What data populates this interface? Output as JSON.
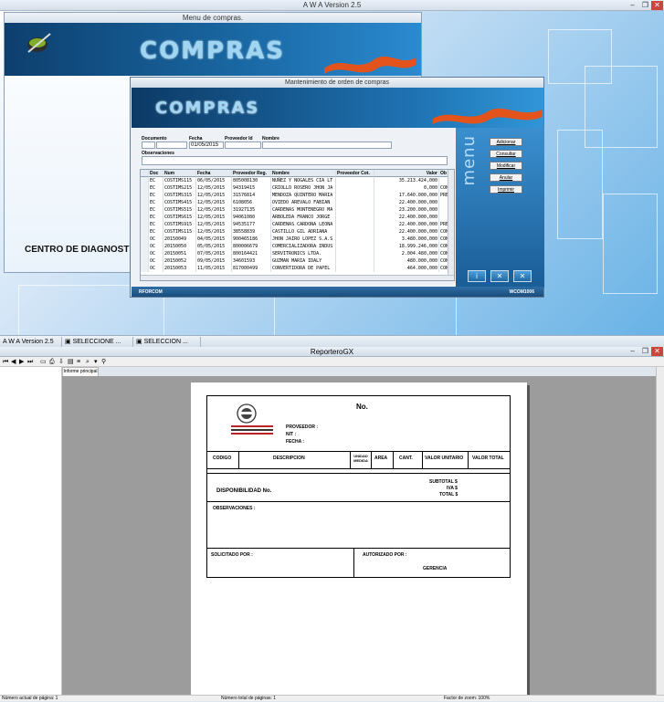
{
  "app": {
    "title": "A W A Version 2.5"
  },
  "menu_window": {
    "title": "Menu de compras.",
    "banner": "COMPRAS",
    "body_text": "CENTRO DE DIAGNOSTIC"
  },
  "mant_window": {
    "title": "Mantenimiento de orden de compras",
    "banner": "COMPRAS",
    "side_banner": "menu",
    "fields": {
      "documento_label": "Documento",
      "fecha_label": "Fecha",
      "fecha_value": "01/05/2015",
      "proveedor_label": "Proveedor Id",
      "nombre_label": "Nombre",
      "observaciones_label": "Observaciones"
    },
    "grid": {
      "headers": [
        "Doc",
        "Num",
        "Fecha",
        "Proveedor Reg.",
        "Nombre",
        "Proveedor Cot.",
        "Valor",
        "Ob"
      ],
      "rows": [
        [
          "EC",
          "COSTIMS115",
          "06/05/2015",
          "805008130",
          "NUÑEZ Y NOGALES CIA LT",
          "",
          "35.213.424,000",
          ""
        ],
        [
          "EC",
          "COSTIMS215",
          "12/05/2015",
          "94319415",
          "CRIOLLO ROSERO JHON JA",
          "",
          "0,000",
          "CON"
        ],
        [
          "EC",
          "COSTIMS315",
          "12/05/2015",
          "31576814",
          "MENDOZA QUINTERO MARIA",
          "",
          "17.640.000,000",
          "PRE"
        ],
        [
          "EC",
          "COSTIMS415",
          "12/05/2015",
          "6108056",
          "OVIEDO AREVALO FABIAN",
          "",
          "22.400.000,000",
          ""
        ],
        [
          "EC",
          "COSTIMS515",
          "12/05/2015",
          "31927135",
          "CARDENAS MONTENEGRO MA",
          "",
          "23.200.000,000",
          ""
        ],
        [
          "EC",
          "COSTIMS615",
          "12/05/2015",
          "94061080",
          "ARBOLEDA FRANCO JORGE",
          "",
          "22.400.000,000",
          ""
        ],
        [
          "EC",
          "COSTIMS915",
          "12/05/2015",
          "94535177",
          "CARDENAS CARDONA LEONA",
          "",
          "22.400.000,000",
          "PRE"
        ],
        [
          "EC",
          "COSTIMS115",
          "12/05/2015",
          "38558839",
          "CASTILLO GIL ADRIANA",
          "",
          "22.400.000,000",
          "CON"
        ],
        [
          "OC",
          "20150049",
          "04/05/2015",
          "900465186",
          "JHON JAIRO LOPEZ S.A.S",
          "",
          "3.480.000,000",
          "CON"
        ],
        [
          "OC",
          "20150050",
          "05/05/2015",
          "800006679",
          "COMERCIALIZADORA INDUS",
          "",
          "18.999.246,000",
          "CON"
        ],
        [
          "OC",
          "20150051",
          "07/05/2015",
          "800164421",
          "SERVITRONICS LTDA.",
          "",
          "2.004.480,000",
          "CON"
        ],
        [
          "OC",
          "20150052",
          "09/05/2015",
          "34601593",
          "GUZMAN  MARIA IDALY",
          "",
          "480.000,000",
          "CON"
        ],
        [
          "OC",
          "20150053",
          "11/05/2015",
          "817000499",
          "CONVERTIDORA DE PAPEL",
          "",
          "464.000,000",
          "CON"
        ]
      ]
    },
    "buttons": {
      "adicionar": "Adicionar",
      "consultar": "Consultar",
      "modificar": "Modificar",
      "anular": "Anular",
      "imprimir": "Imprimir"
    },
    "status_left": "RFORCOM",
    "status_right": "WCOM1006"
  },
  "taskbar": {
    "items": [
      "A W A Version 2.5",
      "SELECCIONE ...",
      "SELECCION ..."
    ]
  },
  "reporter": {
    "title": "ReporteroGX",
    "tab": "Informe principal",
    "status_left": "Número actual de página: 1",
    "status_mid": "Número total de páginas: 1",
    "status_right": "Factor de zoom: 100%",
    "report": {
      "no_label": "No.",
      "proveedor": "PROVEEDOR :",
      "nit": "NIT :",
      "fecha": "FECHA :",
      "col_codigo": "CODIGO",
      "col_descripcion": "DESCRIPCION",
      "col_unidad": "UNIDAD MEDIDA",
      "col_area": "AREA",
      "col_cant": "CANT.",
      "col_valor_unitario": "VALOR UNITARIO",
      "col_valor_total": "VALOR TOTAL",
      "subtotal": "SUBTOTAL $",
      "iva": "IVA $",
      "total": "TOTAL $",
      "disponibilidad": "DISPONIBILIDAD No.",
      "observaciones": "OBSERVACIONES :",
      "solicitado": "SOLICITADO POR :",
      "autorizado": "AUTORIZADO POR :",
      "gerencia": "GERENCIA"
    }
  }
}
